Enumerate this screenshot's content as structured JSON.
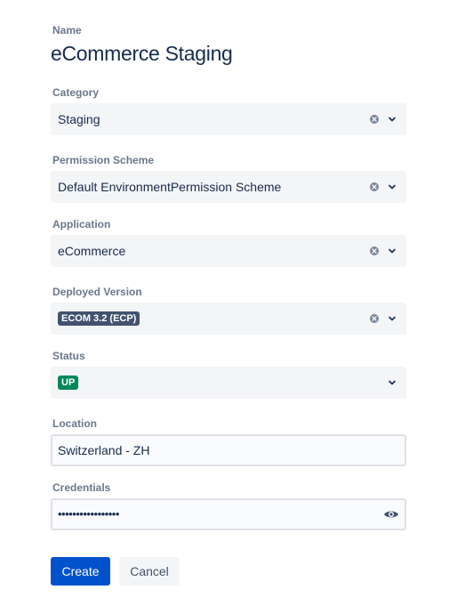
{
  "name": {
    "label": "Name",
    "value": "eCommerce Staging"
  },
  "category": {
    "label": "Category",
    "value": "Staging"
  },
  "permission_scheme": {
    "label": "Permission Scheme",
    "value": "Default EnvironmentPermission Scheme"
  },
  "application": {
    "label": "Application",
    "value": "eCommerce"
  },
  "deployed_version": {
    "label": "Deployed Version",
    "value": "ECOM 3.2 (ECP)"
  },
  "status": {
    "label": "Status",
    "value": "UP"
  },
  "location": {
    "label": "Location",
    "value": "Switzerland - ZH"
  },
  "credentials": {
    "label": "Credentials",
    "value": "•••••••••••••••••"
  },
  "actions": {
    "create_label": "Create",
    "cancel_label": "Cancel"
  },
  "icons": {
    "clear": "clear-icon",
    "chevron": "chevron-down-icon",
    "eye": "eye-icon"
  },
  "colors": {
    "primary": "#0052cc",
    "text": "#172b4d",
    "label": "#6b778c",
    "field_bg": "#f4f5f7",
    "lozenge_dark": "#42526e",
    "lozenge_green": "#00875a"
  }
}
